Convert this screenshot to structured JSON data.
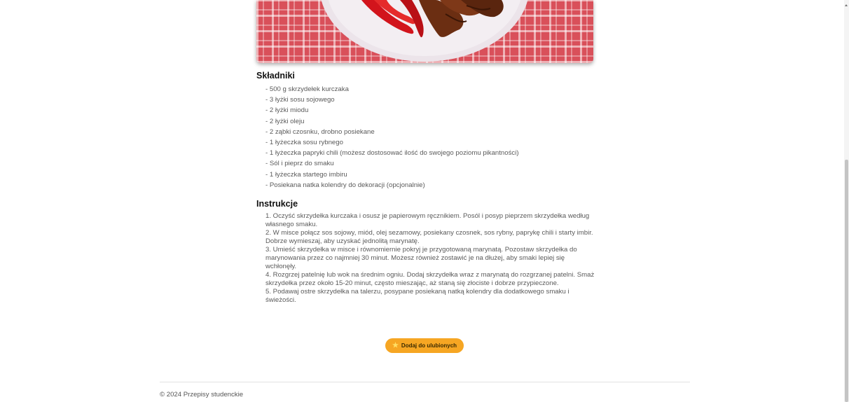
{
  "recipe": {
    "ingredients_heading": "Składniki",
    "ingredients": [
      "- 500 g skrzydełek kurczaka",
      "- 3 łyżki sosu sojowego",
      "- 2 łyżki miodu",
      "- 2 łyżki oleju",
      "- 2 ząbki czosnku, drobno posiekane",
      "- 1 łyżeczka sosu rybnego",
      "- 1 łyżeczka papryki chili (możesz dostosować ilość do swojego poziomu pikantności)",
      "- Sól i pieprz do smaku",
      "- 1 łyżeczka startego imbiru",
      "- Posiekana natka kolendry do dekoracji (opcjonalnie)"
    ],
    "instructions_heading": "Instrukcje",
    "instructions": [
      "1. Oczyść skrzydełka kurczaka i osusz je papierowym ręcznikiem. Posól i posyp pieprzem skrzydełka według własnego smaku.",
      "2. W misce połącz sos sojowy, miód, olej sezamowy, posiekany czosnek, sos rybny, paprykę chili i starty imbir. Dobrze wymieszaj, aby uzyskać jednolitą marynatę.",
      "3. Umieść skrzydełka w misce i równomiernie pokryj je przygotowaną marynatą. Pozostaw skrzydełka do marynowania przez co najmniej 30 minut. Możesz również zostawić je na dłużej, aby smaki lepiej się wchłonęły.",
      "4. Rozgrzej patelnię lub wok na średnim ogniu. Dodaj skrzydełka wraz z marynatą do rozgrzanej patelni. Smaż skrzydełka przez około 15-20 minut, często mieszając, aż staną się złociste i dobrze przypieczone.",
      "5. Podawaj ostre skrzydełka na talerzu, posypane posiekaną natką kolendry dla dodatkowego smaku i świeżości."
    ],
    "favorite_button_label": "Dodaj do ulubionych",
    "favorite_icon": "star-icon"
  },
  "footer": {
    "copyright": "© 2024 Przepisy studenckie"
  },
  "colors": {
    "accent": "#f6a623",
    "heading": "#111111",
    "body_text": "#5a5a5a"
  }
}
